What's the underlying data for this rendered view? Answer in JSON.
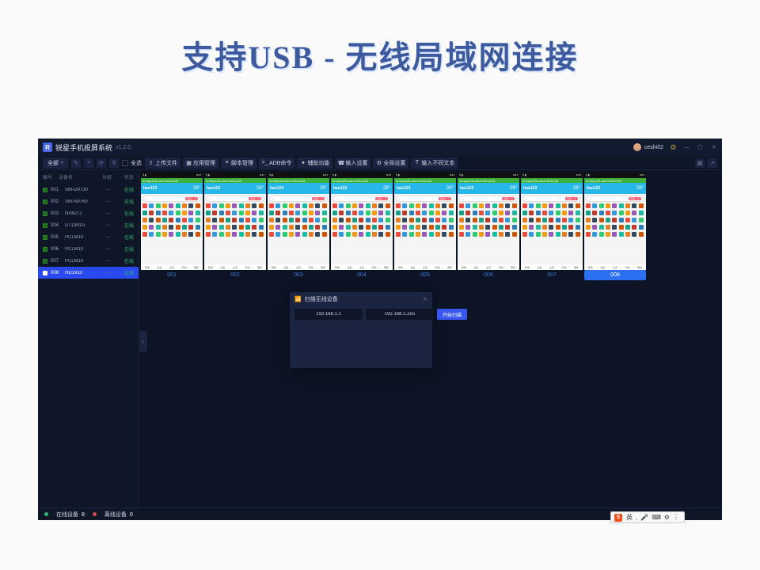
{
  "hero_title": "支持USB - 无线局域网连接",
  "app": {
    "name": "锐星手机投屏系统",
    "version": "v1.2.0",
    "user": "ceshi02"
  },
  "toolbar": {
    "filter": "全部",
    "select_all": "全选",
    "buttons": [
      {
        "icon": "upload",
        "label": "上传文件"
      },
      {
        "icon": "apps",
        "label": "应用管理"
      },
      {
        "icon": "script",
        "label": "脚本管理"
      },
      {
        "icon": "terminal",
        "label": "ADB命令"
      },
      {
        "icon": "tool",
        "label": "辅助功能"
      },
      {
        "icon": "phone",
        "label": "输入设置"
      },
      {
        "icon": "gear",
        "label": "全局设置"
      },
      {
        "icon": "text",
        "label": "输入不同文本"
      }
    ]
  },
  "sidebar": {
    "headers": [
      "编号",
      "设备名",
      "分组",
      "状态"
    ],
    "status_text": "在线",
    "rows": [
      {
        "id": "001",
        "name": "SM-G9730",
        "group": "—",
        "selected": false
      },
      {
        "id": "002",
        "name": "SM-N9760",
        "group": "—",
        "selected": false
      },
      {
        "id": "003",
        "name": "NX627J",
        "group": "—",
        "selected": false
      },
      {
        "id": "004",
        "name": "DT1901A",
        "group": "—",
        "selected": false
      },
      {
        "id": "005",
        "name": "PCLM10",
        "group": "—",
        "selected": false
      },
      {
        "id": "006",
        "name": "PCLM10",
        "group": "—",
        "selected": false
      },
      {
        "id": "007",
        "name": "PCLM10",
        "group": "—",
        "selected": false
      },
      {
        "id": "008",
        "name": "HD1910",
        "group": "—",
        "selected": true
      }
    ]
  },
  "phones": {
    "url": "m.hao123.com/?vit=h123",
    "time": "8:47",
    "brand": "hao123",
    "temperature": "28°",
    "search_tag": "百度一下",
    "nav_items": [
      "菜单",
      "书签",
      "主页",
      "历史",
      "刷新"
    ],
    "labels": [
      "001",
      "002",
      "003",
      "004",
      "005",
      "006",
      "007",
      "008"
    ],
    "selected_index": 7
  },
  "scan_dialog": {
    "title": "扫描无线设备",
    "ip_from": "192.168.1.1",
    "ip_to": "192.168.1.255",
    "button": "开始扫描"
  },
  "statusbar": {
    "online_label": "在线设备",
    "online_count": "8",
    "offline_label": "离线设备",
    "offline_count": "0"
  },
  "ime": {
    "logo": "S",
    "items": [
      "英",
      ",",
      "🎤",
      "⌨",
      "⚙",
      "⋮"
    ]
  },
  "icon_colors": [
    "#e74c3c",
    "#3498db",
    "#2ecc71",
    "#f39c12",
    "#9b59b6",
    "#1abc9c",
    "#e67e22",
    "#34495e",
    "#d35400",
    "#16a085",
    "#c0392b",
    "#2980b9"
  ]
}
